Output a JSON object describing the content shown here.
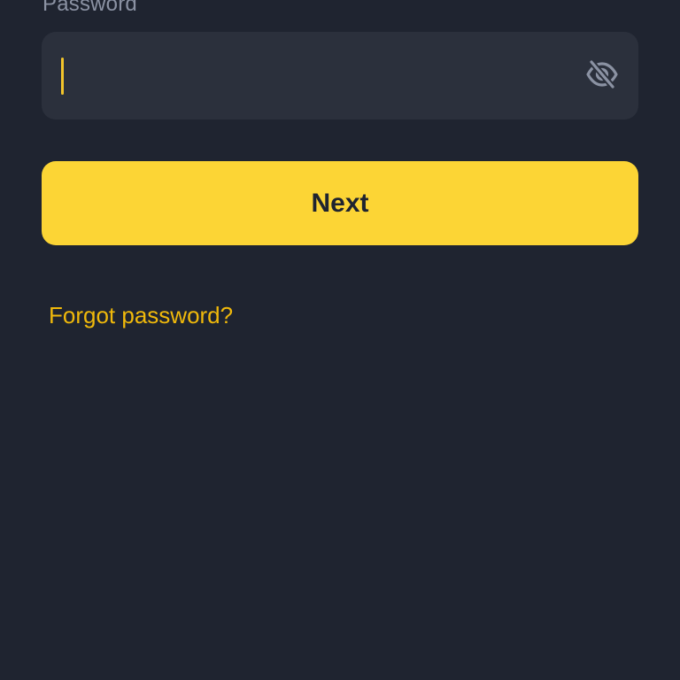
{
  "form": {
    "password_label": "Password",
    "password_value": "",
    "password_placeholder": "",
    "visibility_icon": "eye-off-icon",
    "next_label": "Next",
    "forgot_label": "Forgot password?"
  },
  "colors": {
    "background": "#1f2430",
    "field_background": "#2b303c",
    "accent": "#fcd535",
    "link": "#f0b90b",
    "label": "#8b92a3"
  }
}
